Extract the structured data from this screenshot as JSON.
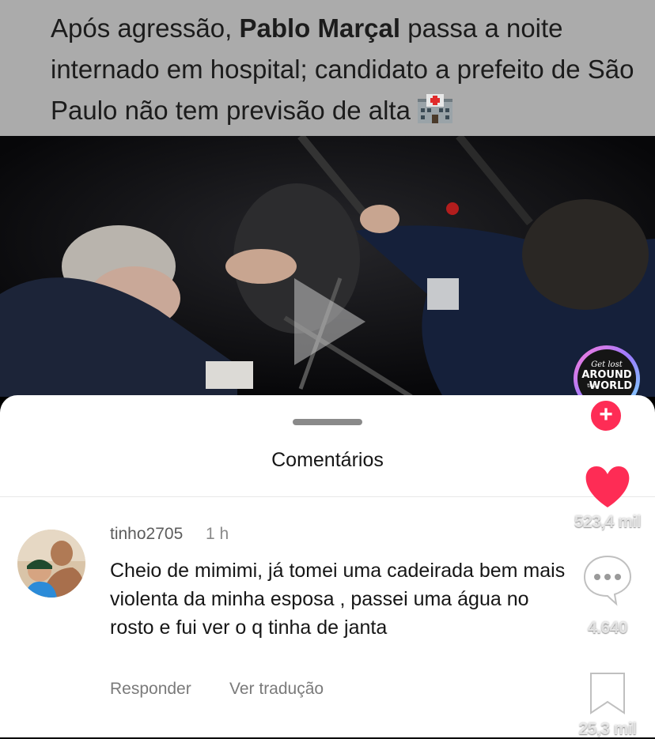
{
  "caption": {
    "prefix": "Após agressão, ",
    "name": "Pablo Marçal",
    "suffix": " passa a noite internado em hospital;  candidato a prefeito de São Paulo não tem previsão de alta",
    "emoji_icon": "hospital-icon"
  },
  "video": {
    "state_icon": "play-icon"
  },
  "rail": {
    "avatar_text": [
      "Get lost",
      "AROUND",
      "the",
      "WORLD"
    ],
    "follow_label": "+",
    "likes": "523,4 mil",
    "comments": "4.640",
    "saves": "25,3 mil",
    "like_color": "#fe2c55"
  },
  "comments_sheet": {
    "title": "Comentários",
    "comment": {
      "username": "tinho2705",
      "time": "1 h",
      "text": "Cheio de mimimi, já tomei uma cadeirada bem mais violenta da minha esposa , passei uma água no rosto e fui ver o q tinha de janta",
      "reply_label": "Responder",
      "translate_label": "Ver tradução"
    }
  }
}
